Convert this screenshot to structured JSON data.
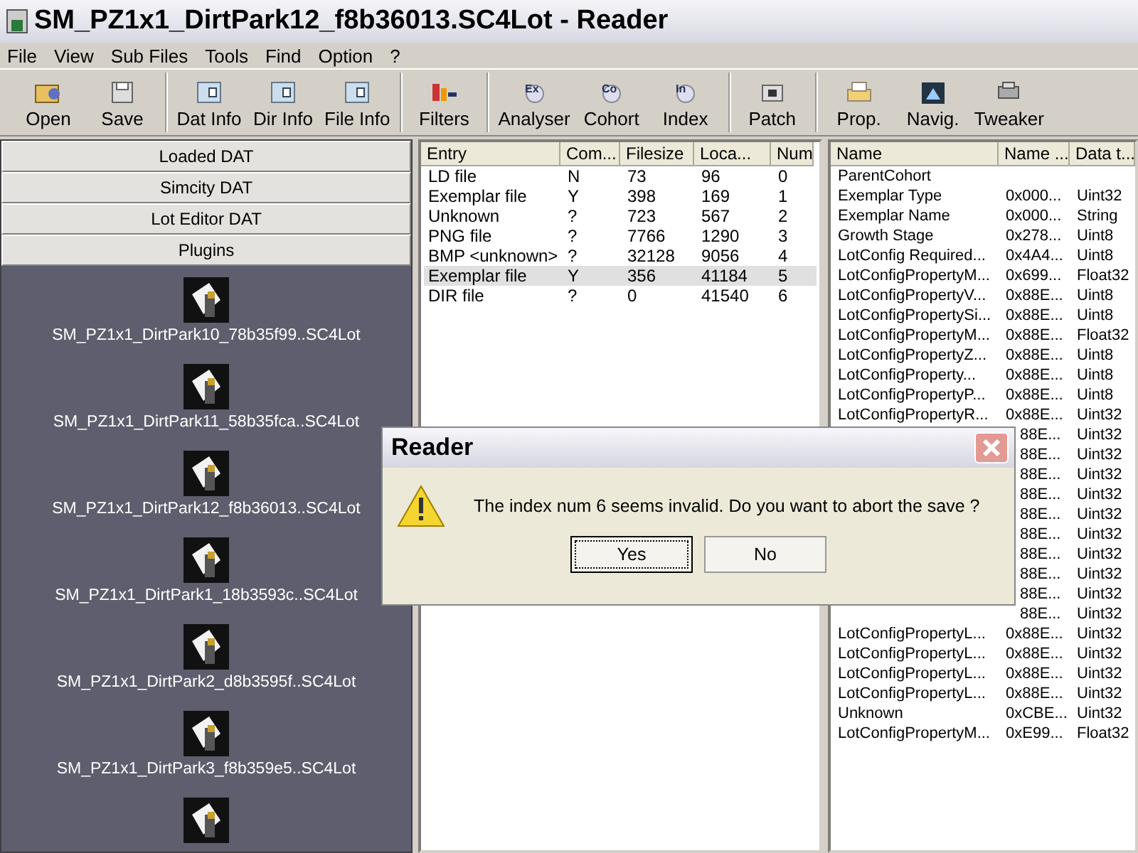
{
  "window": {
    "title": "SM_PZ1x1_DirtPark12_f8b36013.SC4Lot - Reader"
  },
  "menu": [
    "File",
    "View",
    "Sub Files",
    "Tools",
    "Find",
    "Option",
    "?"
  ],
  "toolbar": [
    [
      {
        "label": "Open",
        "kind": "folder"
      },
      {
        "label": "Save",
        "kind": "disk"
      }
    ],
    [
      {
        "label": "Dat Info",
        "kind": "info"
      },
      {
        "label": "Dir Info",
        "kind": "info"
      },
      {
        "label": "File Info",
        "kind": "info"
      }
    ],
    [
      {
        "label": "Filters",
        "kind": "filter"
      }
    ],
    [
      {
        "label": "Analyser",
        "kind": "magnifier",
        "tag": "Ex"
      },
      {
        "label": "Cohort",
        "kind": "magnifier",
        "tag": "Co"
      },
      {
        "label": "Index",
        "kind": "magnifier",
        "tag": "In"
      }
    ],
    [
      {
        "label": "Patch",
        "kind": "patch"
      }
    ],
    [
      {
        "label": "Prop.",
        "kind": "printer"
      },
      {
        "label": "Navig.",
        "kind": "map"
      },
      {
        "label": "Tweaker",
        "kind": "tool"
      }
    ]
  ],
  "sources": {
    "sections": [
      {
        "label": "Loaded DAT"
      },
      {
        "label": "Simcity DAT"
      },
      {
        "label": "Lot Editor DAT"
      },
      {
        "label": "Plugins"
      }
    ],
    "files": [
      {
        "kind": "labeled",
        "label": "SM_PZ1x1_DirtPark10_78b35f99..SC4Lot"
      },
      {
        "kind": "labeled",
        "label": "SM_PZ1x1_DirtPark11_58b35fca..SC4Lot"
      },
      {
        "kind": "labeled",
        "label": "SM_PZ1x1_DirtPark12_f8b36013..SC4Lot"
      },
      {
        "kind": "labeled",
        "label": "SM_PZ1x1_DirtPark1_18b3593c..SC4Lot"
      },
      {
        "kind": "labeled",
        "label": "SM_PZ1x1_DirtPark2_d8b3595f..SC4Lot"
      },
      {
        "kind": "labeled",
        "label": "SM_PZ1x1_DirtPark3_f8b359e5..SC4Lot"
      },
      {
        "kind": "icon"
      }
    ]
  },
  "entries": {
    "columns": [
      "Entry",
      "Com...",
      "Filesize",
      "Loca...",
      "Num"
    ],
    "rows": [
      {
        "cells": [
          "LD file",
          "N",
          "73",
          "96",
          "0"
        ],
        "selected": false
      },
      {
        "cells": [
          "Exemplar file",
          "Y",
          "398",
          "169",
          "1"
        ],
        "selected": false
      },
      {
        "cells": [
          "Unknown",
          "?",
          "723",
          "567",
          "2"
        ],
        "selected": false
      },
      {
        "cells": [
          "PNG file",
          "?",
          "7766",
          "1290",
          "3"
        ],
        "selected": false
      },
      {
        "cells": [
          "BMP <unknown>",
          "?",
          "32128",
          "9056",
          "4"
        ],
        "selected": false
      },
      {
        "cells": [
          "Exemplar file",
          "Y",
          "356",
          "41184",
          "5"
        ],
        "selected": true
      },
      {
        "cells": [
          "DIR file",
          "?",
          "0",
          "41540",
          "6"
        ],
        "selected": false
      }
    ]
  },
  "properties": {
    "columns": [
      "Name",
      "Name ...",
      "Data t..."
    ],
    "rows": [
      {
        "name": "ParentCohort"
      },
      {
        "name": "Exemplar Type",
        "value": "0x000...",
        "type": "Uint32"
      },
      {
        "name": "Exemplar Name",
        "value": "0x000...",
        "type": "String"
      },
      {
        "name": "Growth Stage",
        "value": "0x278...",
        "type": "Uint8"
      },
      {
        "name": "LotConfig Required...",
        "value": "0x4A4...",
        "type": "Uint8"
      },
      {
        "name": "LotConfigPropertyM...",
        "value": "0x699...",
        "type": "Float32"
      },
      {
        "name": "LotConfigPropertyV...",
        "value": "0x88E...",
        "type": "Uint8"
      },
      {
        "name": "LotConfigPropertySi...",
        "value": "0x88E...",
        "type": "Uint8"
      },
      {
        "name": "LotConfigPropertyM...",
        "value": "0x88E...",
        "type": "Float32"
      },
      {
        "name": "LotConfigPropertyZ...",
        "value": "0x88E...",
        "type": "Uint8"
      },
      {
        "name": "LotConfigProperty...",
        "value": "0x88E...",
        "type": "Uint8"
      },
      {
        "name": "LotConfigPropertyP...",
        "value": "0x88E...",
        "type": "Uint8"
      },
      {
        "name": "LotConfigPropertyR...",
        "value": "0x88E...",
        "type": "Uint32"
      },
      {
        "value": "88E...",
        "type": "Uint32"
      },
      {
        "value": "88E...",
        "type": "Uint32"
      },
      {
        "value": "88E...",
        "type": "Uint32"
      },
      {
        "value": "88E...",
        "type": "Uint32"
      },
      {
        "value": "88E...",
        "type": "Uint32"
      },
      {
        "value": "88E...",
        "type": "Uint32"
      },
      {
        "value": "88E...",
        "type": "Uint32"
      },
      {
        "value": "88E...",
        "type": "Uint32"
      },
      {
        "value": "88E...",
        "type": "Uint32"
      },
      {
        "value": "88E...",
        "type": "Uint32"
      },
      {
        "name": "LotConfigPropertyL...",
        "value": "0x88E...",
        "type": "Uint32"
      },
      {
        "name": "LotConfigPropertyL...",
        "value": "0x88E...",
        "type": "Uint32"
      },
      {
        "name": "LotConfigPropertyL...",
        "value": "0x88E...",
        "type": "Uint32"
      },
      {
        "name": "LotConfigPropertyL...",
        "value": "0x88E...",
        "type": "Uint32"
      },
      {
        "name": "Unknown",
        "value": "0xCBE...",
        "type": "Uint32"
      },
      {
        "name": "LotConfigPropertyM...",
        "value": "0xE99...",
        "type": "Float32"
      }
    ]
  },
  "dialog": {
    "title": "Reader",
    "message": "The index num 6 seems invalid. Do you want to abort the save ?",
    "buttons": [
      {
        "label": "Yes",
        "focused": true
      },
      {
        "label": "No",
        "focused": false
      }
    ]
  }
}
